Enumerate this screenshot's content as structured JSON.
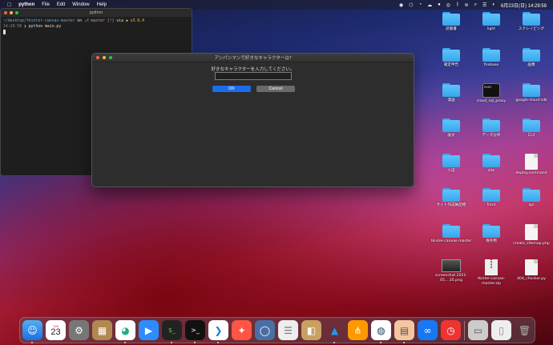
{
  "menubar": {
    "app_name": "python",
    "items": [
      "File",
      "Edit",
      "Window",
      "Help"
    ],
    "clock": "6月23日(日)  14:29:59"
  },
  "terminal": {
    "title": "python",
    "line1_path": "~/desktop/tkinter-canvas-master",
    "line1_on": "on",
    "line1_branch": "master [!]",
    "line1_via": "via",
    "line1_version": "v3.9.4",
    "line2_time": "14:28:58",
    "line2_cmd": "python main.py"
  },
  "dialog": {
    "title": "アンパンマンで好きなキャラクターは?",
    "prompt": "好きなキャラクターを入力してください。",
    "entry_value": "",
    "ok_label": "OK",
    "cancel_label": "Cancel"
  },
  "desktop_icons": [
    {
      "label": "読書書",
      "kind": "folder"
    },
    {
      "label": "light",
      "kind": "folder"
    },
    {
      "label": "スクレイピング",
      "kind": "folder"
    },
    {
      "label": "確定申告",
      "kind": "folder"
    },
    {
      "label": "firebase",
      "kind": "folder"
    },
    {
      "label": "画像",
      "kind": "folder"
    },
    {
      "label": "漫画",
      "kind": "folder"
    },
    {
      "label": "cloud_sql_proxy",
      "kind": "terminal"
    },
    {
      "label": "google-cloud-sdk",
      "kind": "folder"
    },
    {
      "label": "論文",
      "kind": "folder"
    },
    {
      "label": "データ分析",
      "kind": "folder"
    },
    {
      "label": "ロゴ",
      "kind": "folder"
    },
    {
      "label": "小説",
      "kind": "folder"
    },
    {
      "label": "site",
      "kind": "folder"
    },
    {
      "label": "deploy.command",
      "kind": "doc"
    },
    {
      "label": "サイト作成納品物",
      "kind": "folder"
    },
    {
      "label": "front",
      "kind": "folder"
    },
    {
      "label": "api",
      "kind": "folder"
    },
    {
      "label": "tkinter-canvas-master",
      "kind": "folder"
    },
    {
      "label": "保存用",
      "kind": "folder"
    },
    {
      "label": "create_sitemap.php",
      "kind": "doc"
    },
    {
      "label": "screenshot 2021-05....35.png",
      "kind": "shot"
    },
    {
      "label": "tkinter-canvas-master.zip",
      "kind": "zip"
    },
    {
      "label": "404_checker.py",
      "kind": "doc"
    }
  ],
  "dock": {
    "calendar_month": "JUN",
    "calendar_day": "23"
  }
}
